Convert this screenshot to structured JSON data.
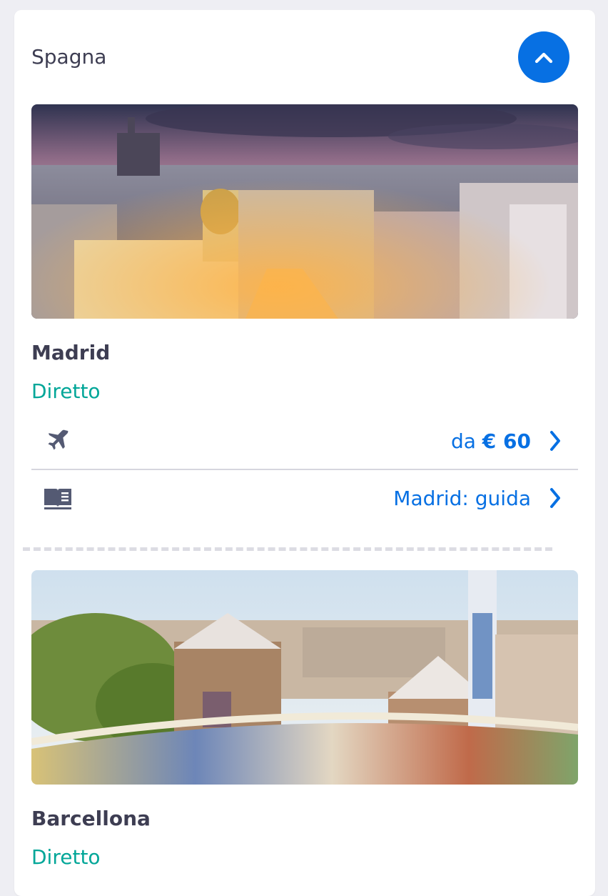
{
  "section": {
    "title": "Spagna",
    "toggle_icon": "chevron-up-icon",
    "accent_color": "#0770e3"
  },
  "destinations": [
    {
      "name": "Madrid",
      "tag": "Diretto",
      "photo": "Madrid city skyline at dusk with Metropolis building",
      "flight_icon": "airplane-icon",
      "price_prefix": "da",
      "price": "€ 60",
      "guide_icon": "book-icon",
      "guide_label": "Madrid: guida"
    },
    {
      "name": "Barcellona",
      "tag": "Diretto",
      "photo": "Park Güell mosaic terrace overlooking Barcelona"
    }
  ],
  "colors": {
    "tag": "#00a698",
    "link": "#0770e3",
    "text": "#3d3d52"
  }
}
